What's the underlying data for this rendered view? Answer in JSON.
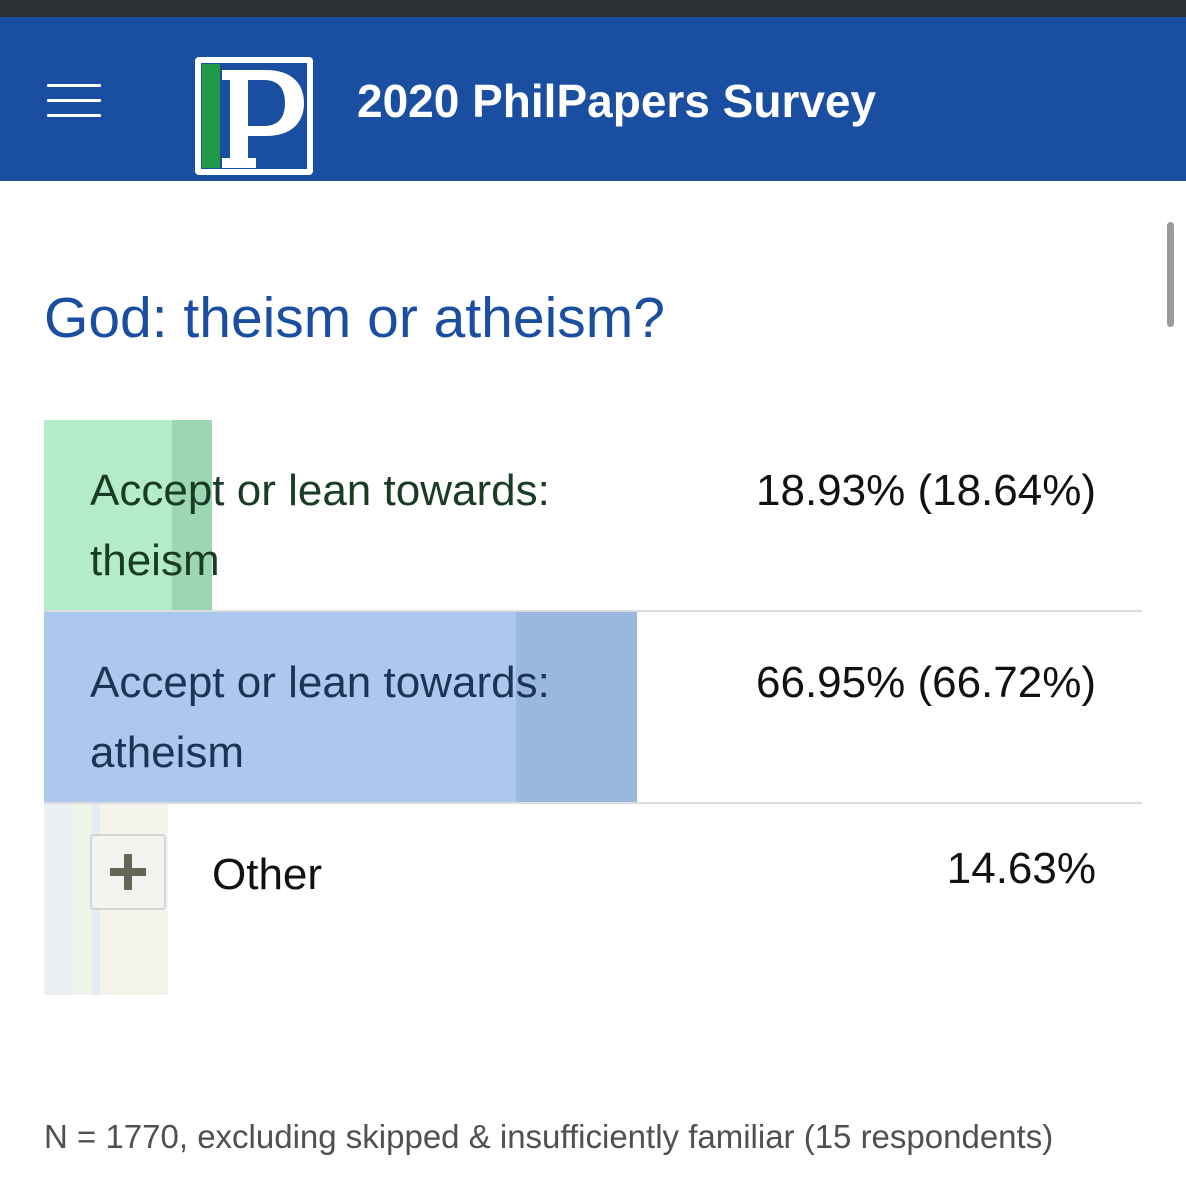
{
  "header": {
    "site_title": "2020 PhilPapers Survey",
    "logo_letter": "P",
    "background_color": "#1a4ea0"
  },
  "question": {
    "title": "God: theism or atheism?"
  },
  "results": [
    {
      "label_line1": "Accept or lean towards:",
      "label_line2": "theism",
      "value_text": "18.93% (18.64%)",
      "percent": 18.93,
      "alt_percent": 18.64,
      "color": "#b4ebc8"
    },
    {
      "label_line1": "Accept or lean towards:",
      "label_line2": "atheism",
      "value_text": "66.95% (66.72%)",
      "percent": 66.95,
      "alt_percent": 66.72,
      "color": "#acc8ef"
    },
    {
      "label": "Other",
      "value_text": "14.63%",
      "percent": 14.63,
      "expand_icon": "plus-icon"
    }
  ],
  "footnote": "N = 1770, excluding skipped & insufficiently familiar (15 respondents)"
}
